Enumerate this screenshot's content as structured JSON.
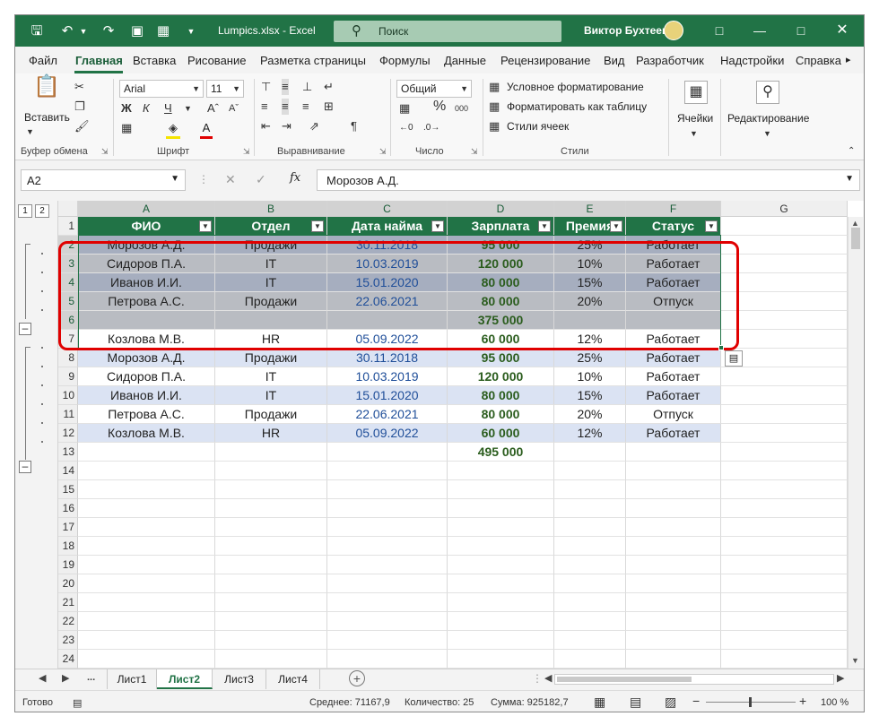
{
  "titlebar": {
    "filename": "Lumpics.xlsx  -  Excel",
    "search_placeholder": "Поиск",
    "user_name": "Виктор Бухтеев"
  },
  "ribbon_tabs": [
    "Файл",
    "Главная",
    "Вставка",
    "Рисование",
    "Разметка страницы",
    "Формулы",
    "Данные",
    "Рецензирование",
    "Вид",
    "Разработчик",
    "Надстройки",
    "Справка"
  ],
  "ribbon": {
    "clipboard": {
      "paste": "Вставить",
      "label": "Буфер обмена"
    },
    "font": {
      "name": "Arial",
      "size": "11",
      "bold": "Ж",
      "italic": "К",
      "underline": "Ч",
      "label": "Шрифт"
    },
    "alignment": {
      "label": "Выравнивание"
    },
    "number": {
      "format": "Общий",
      "percent": "%",
      "thousands": "000",
      "label": "Число"
    },
    "styles": {
      "conditional": "Условное форматирование",
      "as_table": "Форматировать как таблицу",
      "cell_styles": "Стили ячеек",
      "label": "Стили"
    },
    "cells": {
      "label": "Ячейки"
    },
    "editing": {
      "label": "Редактирование"
    }
  },
  "formula_bar": {
    "name_box": "A2",
    "fx": "fx",
    "formula": "Морозов А.Д."
  },
  "outline_levels": [
    "1",
    "2"
  ],
  "columns": [
    "A",
    "B",
    "C",
    "D",
    "E",
    "F",
    "G"
  ],
  "table_headers": [
    "ФИО",
    "Отдел",
    "Дата найма",
    "Зарплата",
    "Премия",
    "Статус"
  ],
  "rows": [
    {
      "n": "2",
      "cells": [
        "Морозов А.Д.",
        "Продажи",
        "30.11.2018",
        "95 000",
        "25%",
        "Работает"
      ]
    },
    {
      "n": "3",
      "cells": [
        "Сидоров П.А.",
        "IT",
        "10.03.2019",
        "120 000",
        "10%",
        "Работает"
      ]
    },
    {
      "n": "4",
      "cells": [
        "Иванов И.И.",
        "IT",
        "15.01.2020",
        "80 000",
        "15%",
        "Работает"
      ]
    },
    {
      "n": "5",
      "cells": [
        "Петрова А.С.",
        "Продажи",
        "22.06.2021",
        "80 000",
        "20%",
        "Отпуск"
      ]
    },
    {
      "n": "6",
      "cells": [
        "",
        "",
        "",
        "375 000",
        "",
        ""
      ]
    },
    {
      "n": "7",
      "cells": [
        "Козлова М.В.",
        "HR",
        "05.09.2022",
        "60 000",
        "12%",
        "Работает"
      ]
    },
    {
      "n": "8",
      "cells": [
        "Морозов А.Д.",
        "Продажи",
        "30.11.2018",
        "95 000",
        "25%",
        "Работает"
      ]
    },
    {
      "n": "9",
      "cells": [
        "Сидоров П.А.",
        "IT",
        "10.03.2019",
        "120 000",
        "10%",
        "Работает"
      ]
    },
    {
      "n": "10",
      "cells": [
        "Иванов И.И.",
        "IT",
        "15.01.2020",
        "80 000",
        "15%",
        "Работает"
      ]
    },
    {
      "n": "11",
      "cells": [
        "Петрова А.С.",
        "Продажи",
        "22.06.2021",
        "80 000",
        "20%",
        "Отпуск"
      ]
    },
    {
      "n": "12",
      "cells": [
        "Козлова М.В.",
        "HR",
        "05.09.2022",
        "60 000",
        "12%",
        "Работает"
      ]
    },
    {
      "n": "13",
      "cells": [
        "",
        "",
        "",
        "495 000",
        "",
        ""
      ]
    }
  ],
  "empty_rows": [
    "14",
    "15",
    "16",
    "17",
    "18",
    "19",
    "20",
    "21",
    "22",
    "23",
    "24"
  ],
  "sheet_tabs": [
    "Лист1",
    "Лист2",
    "Лист3",
    "Лист4"
  ],
  "sheet_nav_more": "...",
  "active_sheet": "Лист2",
  "statusbar": {
    "ready": "Готово",
    "average": "Среднее: 71167,9",
    "count": "Количество: 25",
    "sum": "Сумма: 925182,7",
    "zoom": "100 %"
  },
  "colors": {
    "excel_green": "#217346",
    "highlight_red": "#e00000",
    "band_blue": "#dbe3f3"
  }
}
